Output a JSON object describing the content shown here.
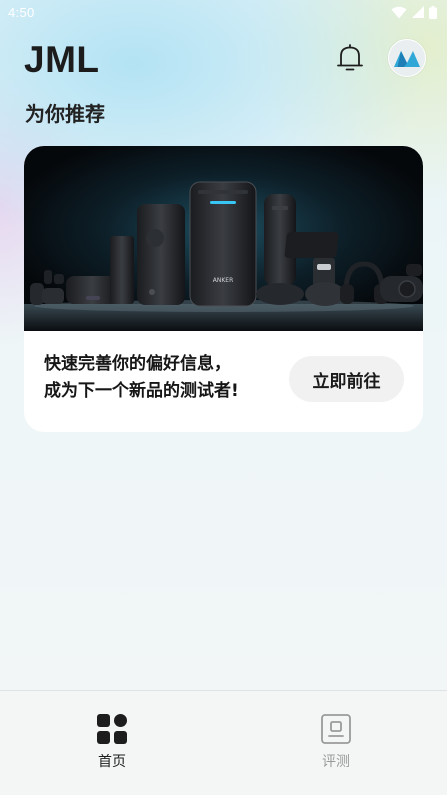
{
  "status_bar": {
    "time": "4:50"
  },
  "header": {
    "title": "JML"
  },
  "section": {
    "title": "为你推荐"
  },
  "promo": {
    "line1": "快速完善你的偏好信息，",
    "line2": "成为下一个新品的测试者!",
    "button_label": "立即前往",
    "image_brand": "ANKER"
  },
  "bottom_nav": {
    "items": [
      {
        "label": "首页",
        "icon": "home-grid-icon",
        "active": true
      },
      {
        "label": "评测",
        "icon": "review-icon",
        "active": false
      }
    ]
  },
  "colors": {
    "background": "#eef6f7",
    "card": "#ffffff",
    "active": "#1d1d1d",
    "inactive": "#9a9a9a",
    "avatar_logo": "#2fa8d8"
  }
}
